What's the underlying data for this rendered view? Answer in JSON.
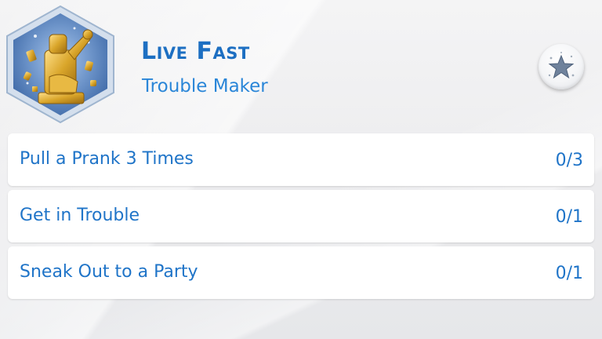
{
  "aspiration": {
    "title": "Live Fast",
    "subtitle": "Trouble Maker",
    "badge_icon": "golden-trouble-maker-trophy-icon",
    "action_icon": "star-icon"
  },
  "tasks": [
    {
      "label": "Pull a Prank 3 Times",
      "progress": "0/3"
    },
    {
      "label": "Get in Trouble",
      "progress": "0/1"
    },
    {
      "label": "Sneak Out to a Party",
      "progress": "0/1"
    }
  ],
  "colors": {
    "text_blue": "#1f74c8",
    "badge_border": "#b6cae0",
    "badge_fill": "#6f94c7",
    "trophy_gold": "#d9a82a"
  }
}
